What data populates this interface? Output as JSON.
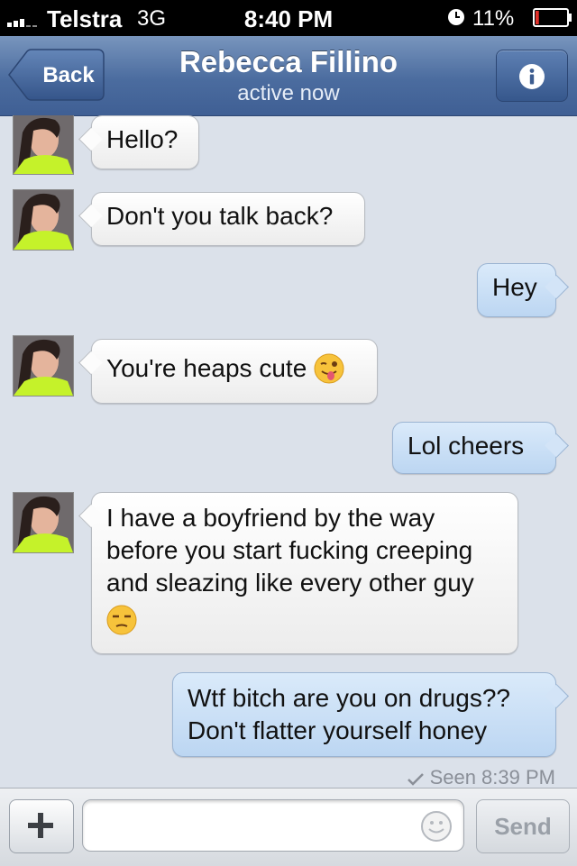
{
  "status_bar": {
    "carrier": "Telstra",
    "network": "3G",
    "time": "8:40 PM",
    "battery": "11%",
    "battery_level": 0.11
  },
  "nav": {
    "back_label": "Back",
    "title": "Rebecca Fillino",
    "subtitle": "active now",
    "info_icon": "info-icon"
  },
  "messages": [
    {
      "from": "them",
      "text": "Hello?"
    },
    {
      "from": "them",
      "text": "Don't you talk back?"
    },
    {
      "from": "me",
      "text": "Hey"
    },
    {
      "from": "them",
      "text": "You're heaps cute",
      "emoji": "winking-tongue-face"
    },
    {
      "from": "me",
      "text": "Lol cheers"
    },
    {
      "from": "them",
      "text_lines": [
        "I have a boyfriend by the way",
        "before you start fucking creeping",
        "and sleazing like every other guy"
      ],
      "emoji": "unamused-face"
    },
    {
      "from": "me",
      "text_lines": [
        "Wtf bitch are you on drugs??",
        "Don't flatter yourself honey"
      ]
    }
  ],
  "seen": "Seen 8:39 PM",
  "composer": {
    "add_icon": "plus-icon",
    "input_value": "",
    "emoji_icon": "smiley-icon",
    "send_label": "Send"
  },
  "colors": {
    "nav_bar": "#4b6c9f",
    "sent_bubble": "#c9def5",
    "received_bubble": "#ffffff",
    "background": "#dbe1ea"
  }
}
